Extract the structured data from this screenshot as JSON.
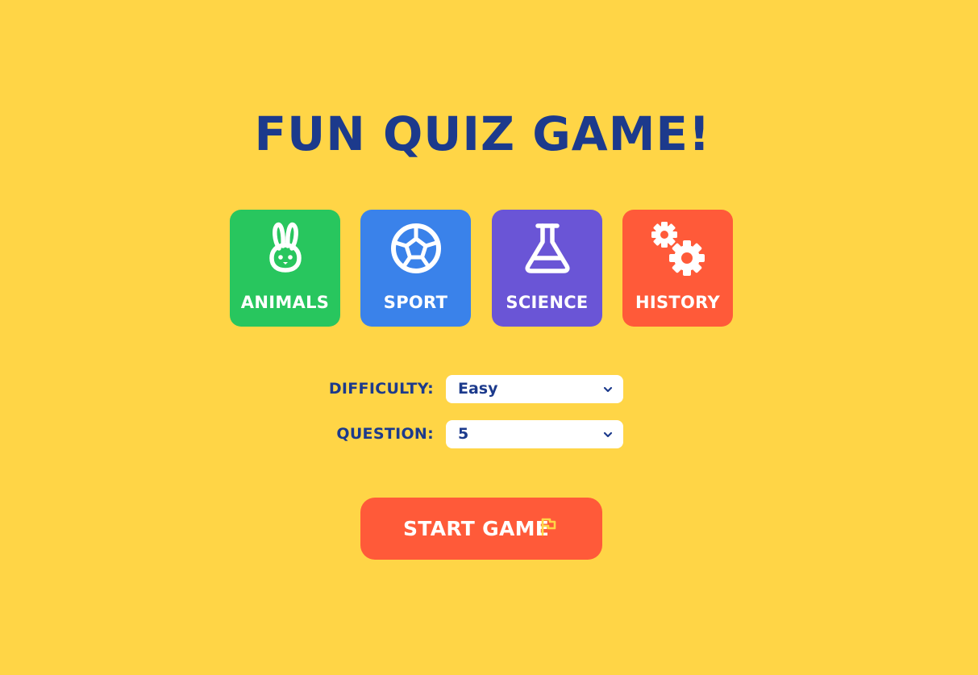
{
  "title": "FUN QUIZ GAME!",
  "categories": [
    {
      "label": "ANIMALS",
      "icon": "rabbit-icon",
      "color": "#28C65E"
    },
    {
      "label": "SPORT",
      "icon": "soccer-ball-icon",
      "color": "#3A82EA"
    },
    {
      "label": "SCIENCE",
      "icon": "flask-icon",
      "color": "#6A55D6"
    },
    {
      "label": "HISTORY",
      "icon": "gears-icon",
      "color": "#FF5A39"
    }
  ],
  "options": {
    "difficulty": {
      "label": "DIFFICULTY:",
      "value": "Easy"
    },
    "question": {
      "label": "QUESTION:",
      "value": "5"
    }
  },
  "start_button": {
    "label": "START GAME",
    "icon": "flag-icon"
  },
  "colors": {
    "background": "#FFD546",
    "primary_text": "#1C3A8C",
    "start_button": "#FF5A39",
    "flag_icon": "#FFD546"
  }
}
